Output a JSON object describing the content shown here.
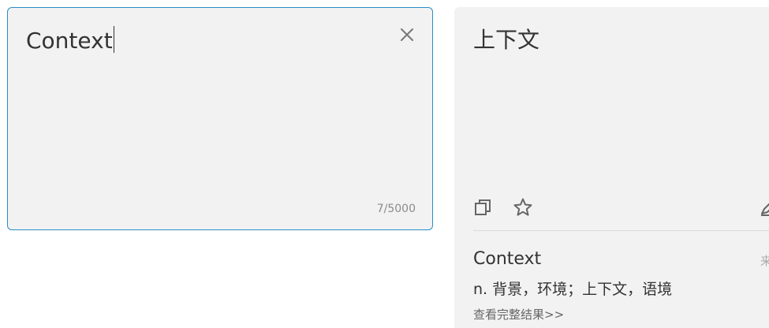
{
  "source": {
    "text": "Context",
    "char_count": "7/5000",
    "clear_icon": "close-icon"
  },
  "target": {
    "text": "上下文",
    "icons": [
      "copy-icon",
      "star-icon",
      "edit-icon"
    ]
  },
  "dictionary": {
    "word": "Context",
    "source_label": "来",
    "definition": "n. 背景，环境；上下文，语境",
    "more_link": "查看完整结果>>"
  },
  "colors": {
    "panel_bg": "#f2f2f2",
    "focus_border": "#2a8cc7",
    "text": "#333333",
    "muted": "#8a8a8a"
  }
}
